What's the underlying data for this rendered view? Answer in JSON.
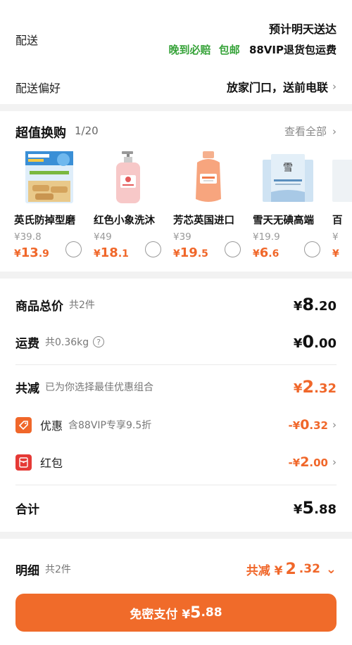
{
  "delivery": {
    "label": "配送",
    "date": "预计明天送达",
    "tag_guarantee": "晚到必赔",
    "tag_freeship": "包邮",
    "tag_vip": "88VIP退货包运费",
    "pref_label": "配送偏好",
    "pref_value": "放家门口，送前电联",
    "chevron": "›"
  },
  "exchange": {
    "title": "超值换购",
    "count": "1/20",
    "view_all": "查看全部",
    "chevron": "›",
    "currency": "¥",
    "products": [
      {
        "name": "英氏防掉型磨",
        "orig": "39.8",
        "price_int": "13",
        "price_dec": ".9",
        "icon": "teether-biscuit-box-icon"
      },
      {
        "name": "红色小象洗沐",
        "orig": "49",
        "price_int": "18",
        "price_dec": ".1",
        "icon": "pink-pump-bottle-icon"
      },
      {
        "name": "芳芯英国进口",
        "orig": "39",
        "price_int": "19",
        "price_dec": ".5",
        "icon": "orange-wash-bottle-icon"
      },
      {
        "name": "雪天无碘高端",
        "orig": "19.9",
        "price_int": "6",
        "price_dec": ".6",
        "icon": "salt-packets-icon"
      },
      {
        "name": "百",
        "orig": "",
        "price_int": "",
        "price_dec": "",
        "icon": "partial-product-icon"
      }
    ]
  },
  "summary": {
    "goods_label": "商品总价",
    "goods_sub": "共2件",
    "goods_yen": "¥",
    "goods_int": "8",
    "goods_dec": ".20",
    "ship_label": "运费",
    "ship_sub": "共0.36kg",
    "ship_info": "?",
    "ship_yen": "¥",
    "ship_int": "0",
    "ship_dec": ".00",
    "reduce_label": "共减",
    "reduce_sub": "已为你选择最佳优惠组合",
    "reduce_yen": "¥",
    "reduce_int": "2",
    "reduce_dec": ".32",
    "coupon_label": "优惠",
    "coupon_sub": "含88VIP专享9.5折",
    "coupon_prefix": "-¥",
    "coupon_int": "0",
    "coupon_dec": ".32",
    "redpack_label": "红包",
    "redpack_prefix": "-¥",
    "redpack_int": "2",
    "redpack_dec": ".00",
    "total_label": "合计",
    "total_yen": "¥",
    "total_int": "5",
    "total_dec": ".88",
    "chevron": "›",
    "accent": "#f0672a"
  },
  "bottom": {
    "detail_label": "明细",
    "detail_sub": "共2件",
    "reduce_prefix": "共减 ¥",
    "reduce_int": "2",
    "reduce_dec": ".32",
    "expand": "⌄",
    "pay_prefix": "免密支付 ¥",
    "pay_int": "5",
    "pay_dec": ".88"
  }
}
